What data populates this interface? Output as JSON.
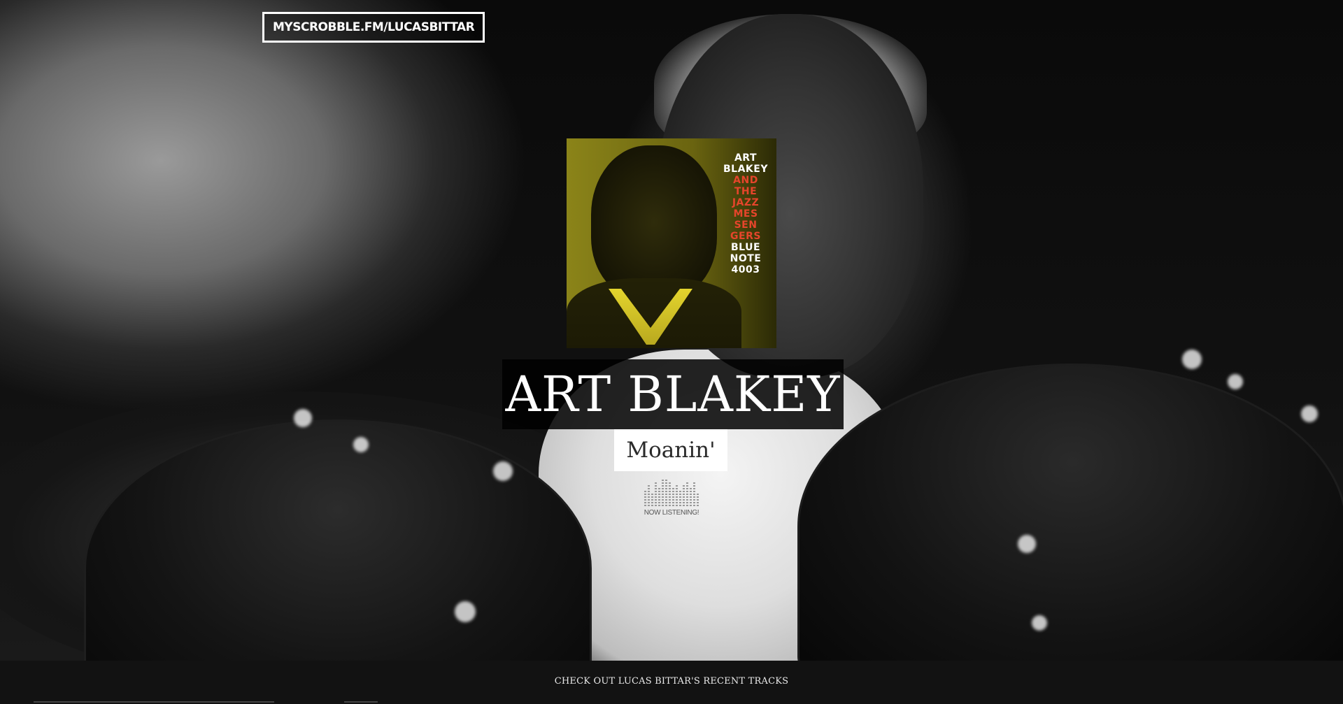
{
  "site": {
    "badge_label": "MYSCROBBLE.FM/LUCASBITTAR"
  },
  "album": {
    "cover_lines_white_top": [
      "ART",
      "BLAKEY"
    ],
    "cover_lines_red": [
      "AND",
      "THE",
      "JAZZ",
      "MES",
      "SEN",
      "GERS"
    ],
    "cover_lines_white_bottom": [
      "BLUE",
      "NOTE",
      "4003"
    ],
    "cover_accent_color": "#e6452b",
    "cover_base_color": "#8b8419"
  },
  "now_playing": {
    "artist": "ART BLAKEY",
    "track": "Moanin'",
    "status_label": "NOW LISTENING!"
  },
  "footer": {
    "recent_tracks_link": "CHECK OUT LUCAS BITTAR'S RECENT TRACKS"
  },
  "icons": {
    "equalizer": "equalizer-icon"
  }
}
